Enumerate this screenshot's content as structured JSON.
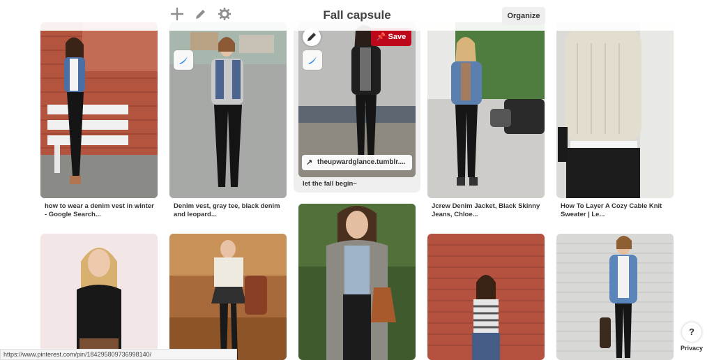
{
  "header": {
    "add_icon": "plus-icon",
    "edit_icon": "pencil-icon",
    "settings_icon": "cog-icon",
    "title": "Fall capsule",
    "organize_label": "Organize"
  },
  "pins": [
    {
      "caption": "how to wear a denim vest in winter - Google Search..."
    },
    {
      "caption": "Denim vest, gray tee, black denim and leopard..."
    },
    {
      "caption": "let the fall begin~",
      "save_label": "Save",
      "link_text": "theupwardglance.tumblr...."
    },
    {
      "caption": "Jcrew Denim Jacket, Black Skinny Jeans, Chloe..."
    },
    {
      "caption": "How To Layer A Cozy Cable Knit Sweater | Le..."
    }
  ],
  "status_bar": {
    "url": "https://www.pinterest.com/pin/184295809736998140/"
  },
  "help": {
    "label": "?",
    "privacy_label": "Privacy"
  },
  "colors": {
    "save_red": "#bd081c",
    "title_gray": "#444444"
  }
}
